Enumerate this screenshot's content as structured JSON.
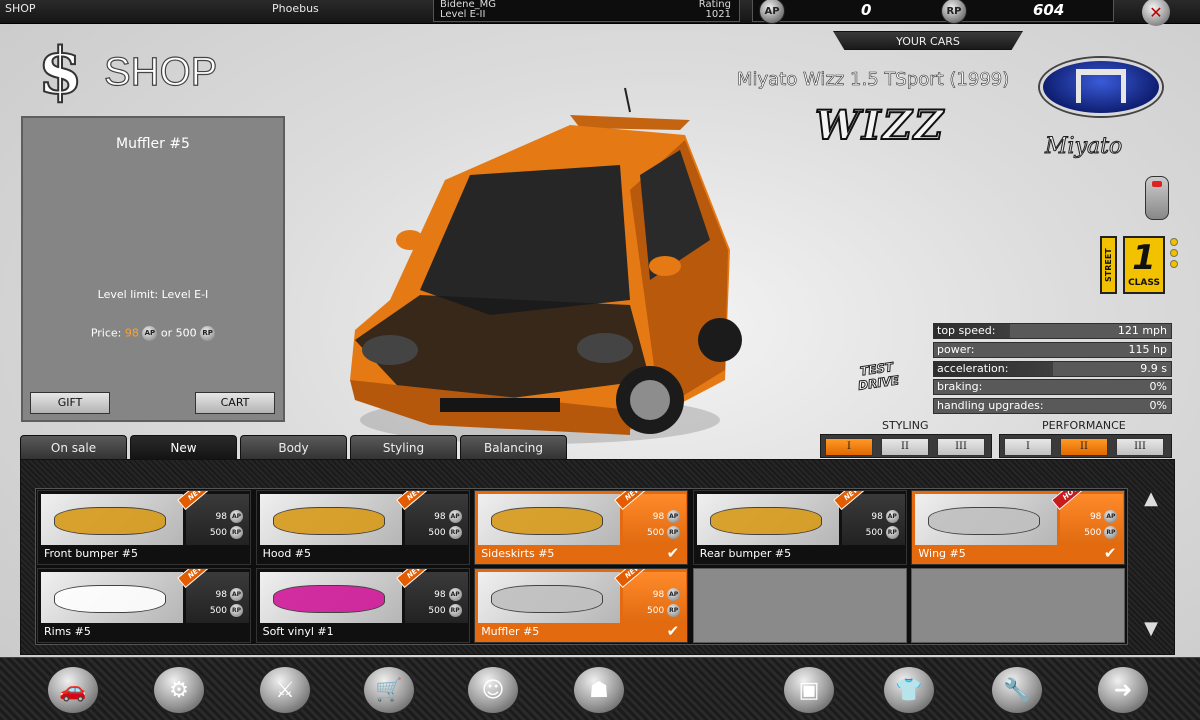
{
  "topbar": {
    "section": "SHOP",
    "username": "Phoebus",
    "player_name": "Bidene_MG",
    "player_level": "Level E-II",
    "rating_label": "Rating",
    "rating_value": "1021",
    "currency_ap": "0",
    "currency_rp": "604",
    "ap_icon": "AP",
    "rp_icon": "RP"
  },
  "your_cars_label": "YOUR CARS",
  "shop_title": "SHOP",
  "detail": {
    "name": "Muffler #5",
    "level_limit": "Level limit: Level E-I",
    "price_prefix": "Price:",
    "price_ap": "98",
    "price_or": "or",
    "price_rp": "500",
    "gift_label": "GIFT",
    "cart_label": "CART"
  },
  "car": {
    "name": "Miyato Wizz 1.5 TSport (1999)",
    "badge": "WIZZ",
    "brand": "Miyato",
    "street_label": "STREET",
    "class_number": "1",
    "class_label": "CLASS",
    "test_drive": "TEST DRIVE",
    "body_color": "#e57a15"
  },
  "stats": [
    {
      "label": "top speed:",
      "value": "121 mph",
      "fill": 0.32
    },
    {
      "label": "power:",
      "value": "115 hp",
      "fill": 0
    },
    {
      "label": "acceleration:",
      "value": "9.9 s",
      "fill": 0.5
    },
    {
      "label": "braking:",
      "value": "0%",
      "fill": 0
    },
    {
      "label": "handling upgrades:",
      "value": "0%",
      "fill": 0
    }
  ],
  "tuning": {
    "styling_label": "STYLING",
    "performance_label": "PERFORMANCE",
    "styling": [
      {
        "label": "I",
        "on": true
      },
      {
        "label": "II",
        "on": false
      },
      {
        "label": "III",
        "on": false
      }
    ],
    "performance": [
      {
        "label": "I",
        "on": false
      },
      {
        "label": "II",
        "on": true
      },
      {
        "label": "III",
        "on": false
      }
    ]
  },
  "tabs": [
    {
      "label": "On sale",
      "active": false
    },
    {
      "label": "New",
      "active": true
    },
    {
      "label": "Body",
      "active": false
    },
    {
      "label": "Styling",
      "active": false
    },
    {
      "label": "Balancing",
      "active": false
    }
  ],
  "items": [
    {
      "name": "Front bumper #5",
      "ap": "98",
      "rp": "500",
      "tag": "NEW",
      "selected": false,
      "thumb": "#d89a1a"
    },
    {
      "name": "Hood #5",
      "ap": "98",
      "rp": "500",
      "tag": "NEW",
      "selected": false,
      "thumb": "#d89a1a"
    },
    {
      "name": "Sideskirts #5",
      "ap": "98",
      "rp": "500",
      "tag": "NEW",
      "selected": true,
      "thumb": "#d89a1a"
    },
    {
      "name": "Rear bumper #5",
      "ap": "98",
      "rp": "500",
      "tag": "NEW",
      "selected": false,
      "thumb": "#d89a1a"
    },
    {
      "name": "Wing #5",
      "ap": "98",
      "rp": "500",
      "tag": "HOT",
      "selected": true,
      "thumb": "#c0c0c0"
    },
    {
      "name": "Rims #5",
      "ap": "98",
      "rp": "500",
      "tag": "NEW",
      "selected": false,
      "thumb": "#ffffff"
    },
    {
      "name": "Soft vinyl #1",
      "ap": "98",
      "rp": "500",
      "tag": "NEW",
      "selected": false,
      "thumb": "#d01a9a"
    },
    {
      "name": "Muffler #5",
      "ap": "98",
      "rp": "500",
      "tag": "NEW",
      "selected": true,
      "thumb": "#c0c0c0"
    }
  ],
  "bottom_nav": [
    {
      "icon": "car-garage-icon",
      "glyph": "🚗"
    },
    {
      "icon": "tuning-parts-icon",
      "glyph": "⚙"
    },
    {
      "icon": "race-helmet-icon",
      "glyph": "⚔"
    },
    {
      "icon": "shop-cart-icon",
      "glyph": "🛒"
    },
    {
      "icon": "character-icon",
      "glyph": "☺"
    },
    {
      "icon": "team-icon",
      "glyph": "☗"
    },
    {
      "icon": "bank-icon",
      "glyph": "▣"
    },
    {
      "icon": "clothing-icon",
      "glyph": "👕"
    },
    {
      "icon": "repair-icon",
      "glyph": "🔧"
    },
    {
      "icon": "exit-icon",
      "glyph": "➜"
    }
  ]
}
